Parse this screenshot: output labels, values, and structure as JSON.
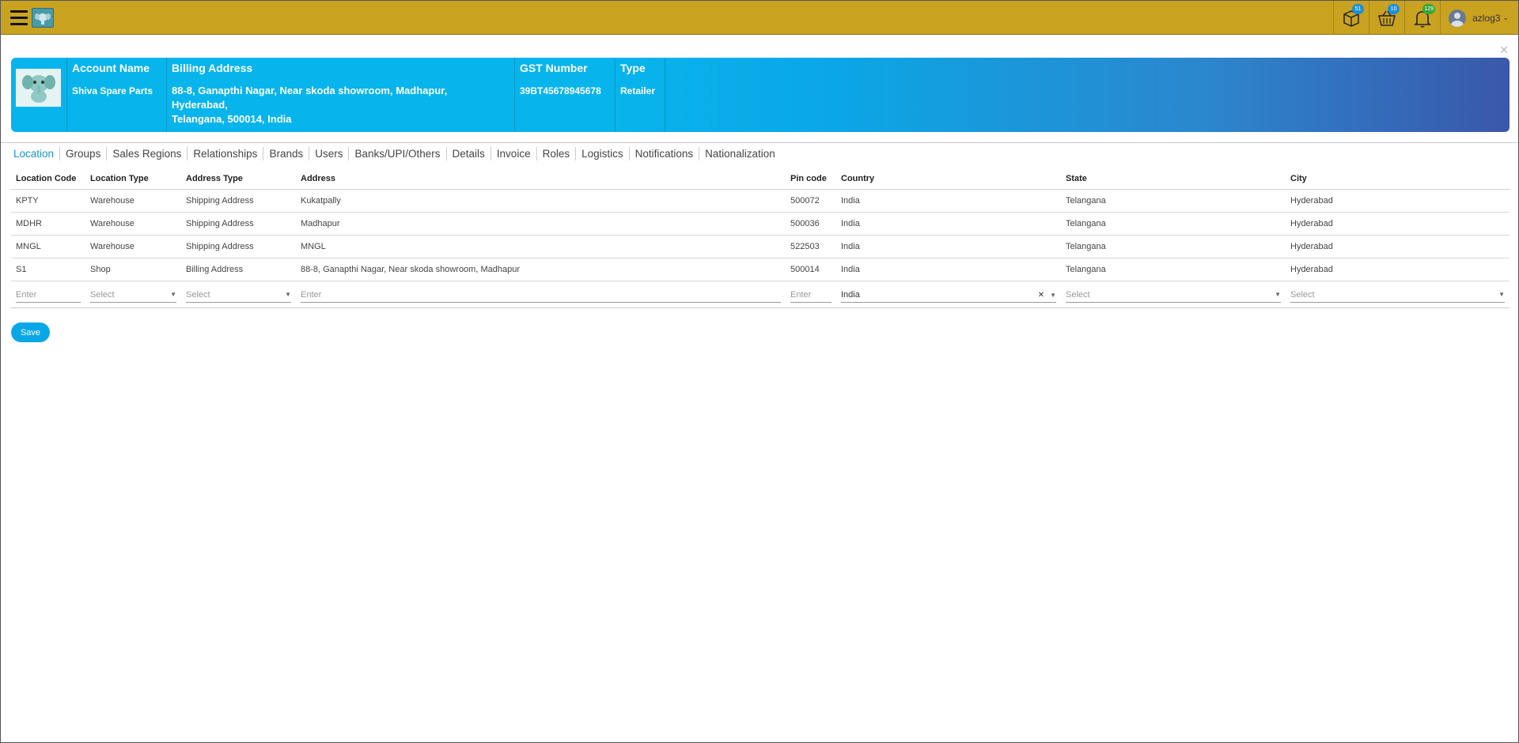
{
  "topbar": {
    "user_name": "azlog3",
    "badges": {
      "packages": "51",
      "cart": "10",
      "notifications": "129"
    }
  },
  "banner": {
    "account_name_label": "Account Name",
    "account_name": "Shiva Spare Parts",
    "billing_label": "Billing Address",
    "billing_line1": "88-8, Ganapthi Nagar, Near skoda showroom, Madhapur,",
    "billing_line2": "Hyderabad,",
    "billing_line3": "Telangana, 500014, India",
    "gst_label": "GST Number",
    "gst": "39BT45678945678",
    "type_label": "Type",
    "type": "Retailer"
  },
  "tabs": [
    "Location",
    "Groups",
    "Sales Regions",
    "Relationships",
    "Brands",
    "Users",
    "Banks/UPI/Others",
    "Details",
    "Invoice",
    "Roles",
    "Logistics",
    "Notifications",
    "Nationalization"
  ],
  "table": {
    "headers": [
      "Location Code",
      "Location Type",
      "Address Type",
      "Address",
      "Pin code",
      "Country",
      "State",
      "City"
    ],
    "rows": [
      [
        "KPTY",
        "Warehouse",
        "Shipping Address",
        "Kukatpally",
        "500072",
        "India",
        "Telangana",
        "Hyderabad"
      ],
      [
        "MDHR",
        "Warehouse",
        "Shipping Address",
        "Madhapur",
        "500036",
        "India",
        "Telangana",
        "Hyderabad"
      ],
      [
        "MNGL",
        "Warehouse",
        "Shipping Address",
        "MNGL",
        "522503",
        "India",
        "Telangana",
        "Hyderabad"
      ],
      [
        "S1",
        "Shop",
        "Billing Address",
        "88-8, Ganapthi Nagar, Near skoda showroom, Madhapur",
        "500014",
        "India",
        "Telangana",
        "Hyderabad"
      ]
    ],
    "entry": {
      "code_placeholder": "Enter",
      "location_type_placeholder": "Select",
      "address_type_placeholder": "Select",
      "address_placeholder": "Enter",
      "pin_placeholder": "Enter",
      "country_value": "India",
      "state_placeholder": "Select",
      "city_placeholder": "Select"
    }
  },
  "save_label": "Save",
  "icons": {
    "menu": "hamburger-icon",
    "packages": "package-icon",
    "cart": "basket-icon",
    "notifications": "bell-icon",
    "close": "close-icon"
  },
  "colors": {
    "topbar": "#c9a220",
    "banner_start": "#08b4ec",
    "banner_end": "#3a57ab",
    "accent": "#0aa7e8",
    "active_tab": "#1a95cf"
  }
}
